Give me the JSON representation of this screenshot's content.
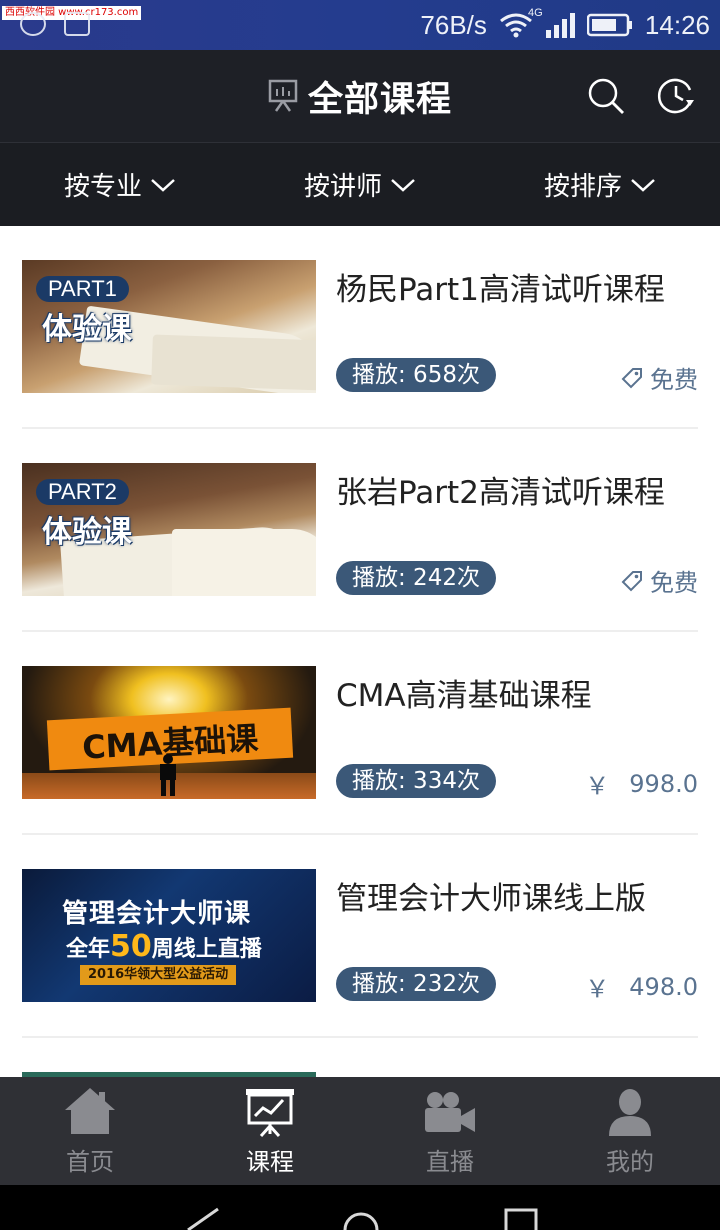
{
  "watermark": "西西软件园 www.cr173.com",
  "status_bar": {
    "net_speed": "76B/s",
    "network": "4G",
    "time": "14:26"
  },
  "header": {
    "title": "全部课程"
  },
  "filters": [
    {
      "label": "按专业"
    },
    {
      "label": "按讲师"
    },
    {
      "label": "按排序"
    }
  ],
  "courses": [
    {
      "title": "杨民Part1高清试听课程",
      "plays": "播放: 658次",
      "price": "免费",
      "price_type": "free",
      "thumb": {
        "part": "PART1",
        "caption": "体验课"
      }
    },
    {
      "title": "张岩Part2高清试听课程",
      "plays": "播放: 242次",
      "price": "免费",
      "price_type": "free",
      "thumb": {
        "part": "PART2",
        "caption": "体验课"
      }
    },
    {
      "title": "CMA高清基础课程",
      "plays": "播放: 334次",
      "currency": "￥",
      "price": "998.0",
      "price_type": "paid",
      "thumb": {
        "banner": "CMA基础课"
      }
    },
    {
      "title": "管理会计大师课线上版",
      "plays": "播放: 232次",
      "currency": "￥",
      "price": "498.0",
      "price_type": "paid",
      "thumb": {
        "line1": "管理会计大师课",
        "line2_pre": "全年",
        "line2_hl": "50",
        "line2_post": "周线上直播",
        "line3": "2016华领大型公益活动"
      }
    }
  ],
  "bottom_nav": [
    {
      "label": "首页",
      "icon": "home-icon",
      "active": false
    },
    {
      "label": "课程",
      "icon": "presentation-icon",
      "active": true
    },
    {
      "label": "直播",
      "icon": "video-camera-icon",
      "active": false
    },
    {
      "label": "我的",
      "icon": "user-icon",
      "active": false
    }
  ],
  "colors": {
    "header_bg": "#1e2026",
    "badge_bg": "#3b5878",
    "price_text": "#5a7390",
    "nav_bg": "#2f3035"
  }
}
